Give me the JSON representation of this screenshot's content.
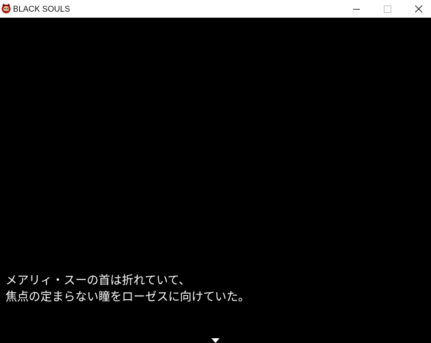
{
  "window": {
    "title": "BLACK SOULS",
    "icon": "game-app-icon"
  },
  "controls": {
    "minimize": "minimize-icon",
    "maximize": "maximize-icon",
    "close": "close-icon"
  },
  "dialogue": {
    "lines": [
      "メアリィ・スーの首は折れていて、",
      "焦点の定まらない瞳をローゼスに向けていた。"
    ],
    "continue_indicator": "continue-arrow-icon"
  },
  "colors": {
    "background": "#000000",
    "text": "#ffffff",
    "titlebar": "#ffffff"
  }
}
